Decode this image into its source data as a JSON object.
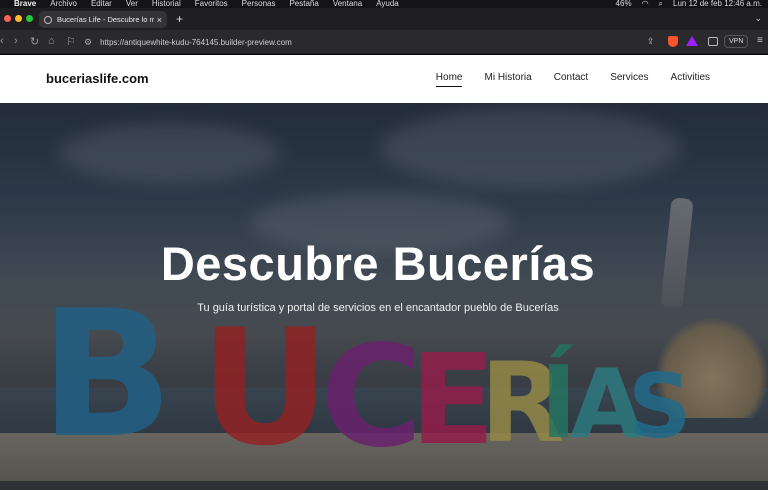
{
  "os_menubar": {
    "app_name": "Brave",
    "menus": [
      "Archivo",
      "Editar",
      "Ver",
      "Historial",
      "Favoritos",
      "Personas",
      "Pestaña",
      "Ventana",
      "Ayuda"
    ],
    "battery": "46%",
    "clock": "Lun 12 de feb  12:46 a.m."
  },
  "browser": {
    "tab_title": "Bucerías Life - Descubre lo m",
    "url": "https://antiquewhite-kudu-764145.builder-preview.com",
    "vpn_label": "VPN"
  },
  "site": {
    "brand": "buceriaslife.com",
    "nav": [
      {
        "label": "Home",
        "active": true
      },
      {
        "label": "Mi Historia",
        "active": false
      },
      {
        "label": "Contact",
        "active": false
      },
      {
        "label": "Services",
        "active": false
      },
      {
        "label": "Activities",
        "active": false
      }
    ],
    "hero": {
      "title": "Descubre Bucerías",
      "subtitle": "Tu guía turística y portal de servicios en el encantador pueblo de Bucerías",
      "sign_letters": [
        "B",
        "U",
        "C",
        "E",
        "R",
        "Í",
        "A",
        "S"
      ],
      "sign_colors": [
        "#2b7fb0",
        "#c42a2a",
        "#8e2a8f",
        "#c8245e",
        "#c9b85a",
        "#2f9a7e",
        "#3aa4a8",
        "#2a8fb8"
      ]
    }
  },
  "colors": {
    "tab_light_red": "#ff5f57",
    "tab_light_yellow": "#febc2e",
    "tab_light_green": "#28c840",
    "brave_orange": "#fb542b"
  }
}
